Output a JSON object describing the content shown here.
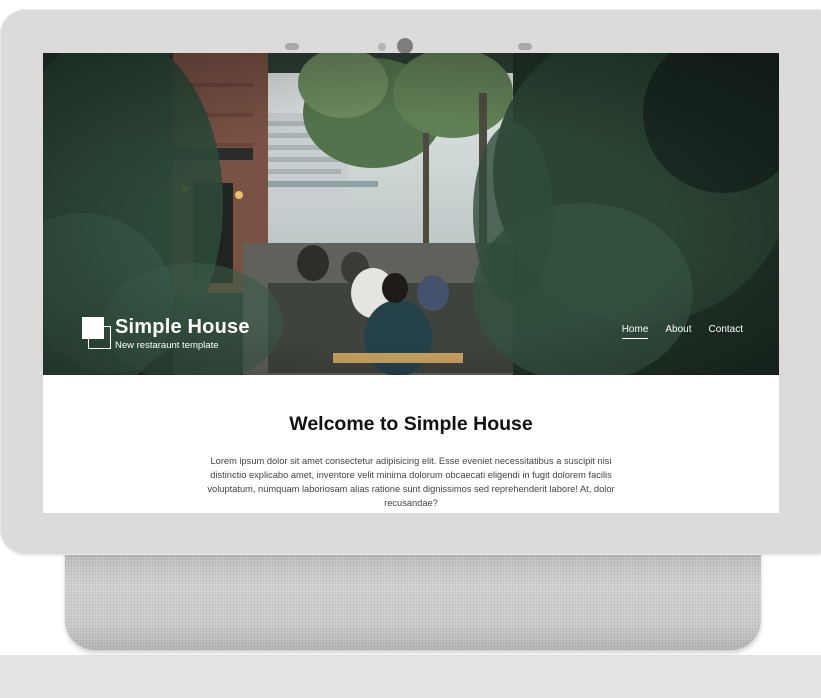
{
  "site": {
    "title": "Simple House",
    "tagline": "New restaraunt template"
  },
  "nav": {
    "items": [
      {
        "label": "Home",
        "active": true
      },
      {
        "label": "About",
        "active": false
      },
      {
        "label": "Contact",
        "active": false
      }
    ]
  },
  "main": {
    "heading": "Welcome to Simple House",
    "intro": "Lorem ipsum dolor sit amet consectetur adipisicing elit. Esse eveniet necessitatibus a suscipit nisi distinctio explicabo amet, inventore velit minima dolorum obcaecati eligendi in fugit dolorem facilis voluptatum, numquam laboriosam alias ratione sunt dignissimos sed reprehenderit labore! At, dolor recusandae?"
  },
  "colors": {
    "device_frame": "#dcdbd9",
    "screen_bg": "#ffffff",
    "hero_overlay": "#2f3e34",
    "text_on_hero": "#ffffff",
    "heading": "#111111",
    "body_text": "#444444"
  }
}
